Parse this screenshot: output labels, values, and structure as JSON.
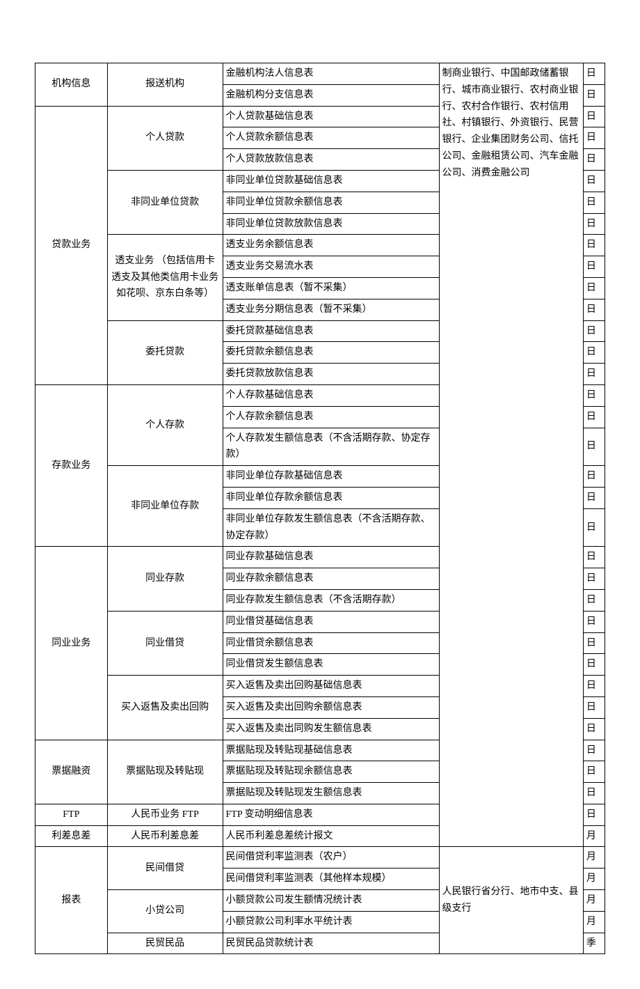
{
  "col4_block1": "制商业银行、中国邮政储蓄银行、城市商业银行、农村商业银行、农村合作银行、农村信用社、村镇银行、外资银行、民营银行、企业集团财务公司、信托公司、金融租赁公司、汽车金融公司、消费金融公司",
  "col4_block2": "人民银行省分行、地市中支、县级支行",
  "rows": [
    {
      "c1": "机构信息",
      "c1span": 2,
      "c2": "报送机构",
      "c2span": 2,
      "c3": "金融机构法人信息表",
      "c5": "日"
    },
    {
      "c3": "金融机构分支信息表",
      "c5": "日"
    },
    {
      "c1": "贷款业务",
      "c1span": 13,
      "c2": "个人贷款",
      "c2span": 3,
      "c3": "个人贷款基础信息表",
      "c5": "日"
    },
    {
      "c3": "个人贷款余额信息表",
      "c5": "日"
    },
    {
      "c3": "个人贷款放款信息表",
      "c5": "日"
    },
    {
      "c2": "非同业单位贷款",
      "c2span": 3,
      "c3": "非同业单位贷款基础信息表",
      "c5": "日"
    },
    {
      "c3": "非同业单位贷款余额信息表",
      "c5": "日"
    },
    {
      "c3": "非同业单位贷款放款信息表",
      "c5": "日"
    },
    {
      "c2": "透支业务\n（包括信用卡透支及其他类信用卡业务如花呗、京东白条等）",
      "c2span": 4,
      "c3": "透支业务余额信息表",
      "c5": "日"
    },
    {
      "c3": "透支业务交易流水表",
      "c5": "日"
    },
    {
      "c3": "透支账单信息表（暂不采集）",
      "c5": "日"
    },
    {
      "c3": "透支业务分期信息表（暂不采集）",
      "c5": "日"
    },
    {
      "c2": "委托贷款",
      "c2span": 3,
      "c3": "委托贷款基础信息表",
      "c5": "日"
    },
    {
      "c3": "委托贷款余额信息表",
      "c5": "日"
    },
    {
      "c3": "委托贷款放款信息表",
      "c5": "日"
    },
    {
      "c1": "存款业务",
      "c1span": 6,
      "c2": "个人存款",
      "c2span": 3,
      "c3": "个人存款基础信息表",
      "c5": "日"
    },
    {
      "c3": "个人存款余额信息表",
      "c5": "日"
    },
    {
      "c3": "个人存款发生额信息表（不含活期存款、协定存款）",
      "c5": "日"
    },
    {
      "c2": "非同业单位存款",
      "c2span": 3,
      "c3": "非同业单位存款基础信息表",
      "c5": "日"
    },
    {
      "c3": "非同业单位存款余额信息表",
      "c5": "日"
    },
    {
      "c3": "非同业单位存款发生额信息表（不含活期存款、协定存款）",
      "c5": "日"
    },
    {
      "c1": "同业业务",
      "c1span": 9,
      "c2": "同业存款",
      "c2span": 3,
      "c3": "同业存款基础信息表",
      "c5": "日"
    },
    {
      "c3": "同业存款余额信息表",
      "c5": "日"
    },
    {
      "c3": "同业存款发生额信息表（不含活期存款）",
      "c5": "日"
    },
    {
      "c2": "同业借贷",
      "c2span": 3,
      "c3": "同业借贷基础信息表",
      "c5": "日"
    },
    {
      "c3": "同业借贷余额信息表",
      "c5": "日"
    },
    {
      "c3": "同业借贷发生额信息表",
      "c5": "日"
    },
    {
      "c2": "买入返售及卖出回购",
      "c2span": 3,
      "c3": "买入返售及卖出回购基础信息表",
      "c5": "日"
    },
    {
      "c3": "买入返售及卖出回购余额信息表",
      "c5": "日"
    },
    {
      "c3": "买入返售及卖出同购发生额信息表",
      "c5": "日"
    },
    {
      "c1": "票据融资",
      "c1span": 3,
      "c2": "票据贴现及转贴现",
      "c2span": 3,
      "c3": "票据贴现及转贴现基础信息表",
      "c5": "日"
    },
    {
      "c3": "票据贴现及转贴现余额信息表",
      "c5": "日"
    },
    {
      "c3": "票据贴现及转贴现发生额信息表",
      "c5": "日"
    },
    {
      "c1": "FTP",
      "c1span": 1,
      "c2": "人民币业务 FTP",
      "c2span": 1,
      "c3": "FTP 变动明细信息表",
      "c5": "日"
    },
    {
      "c1": "利差息差",
      "c1span": 1,
      "c2": "人民币利差息差",
      "c2span": 1,
      "c3": "人民币利差息差统计报文",
      "c5": "月"
    },
    {
      "c1": "报表",
      "c1span": 5,
      "c2": "民间借贷",
      "c2span": 2,
      "c3": "民间借贷利率监测表（农户）",
      "c5": "月"
    },
    {
      "c3": "民间借贷利率监测表（其他样本规模）",
      "c5": "月"
    },
    {
      "c2": "小贷公司",
      "c2span": 2,
      "c3": "小额贷款公司发生额情况统计表",
      "c5": "月"
    },
    {
      "c3": "小额贷款公司利率水平统计表",
      "c5": "月"
    },
    {
      "c2": "民贸民品",
      "c2span": 1,
      "c3": "民贸民品贷款统计表",
      "c5": "季"
    }
  ]
}
